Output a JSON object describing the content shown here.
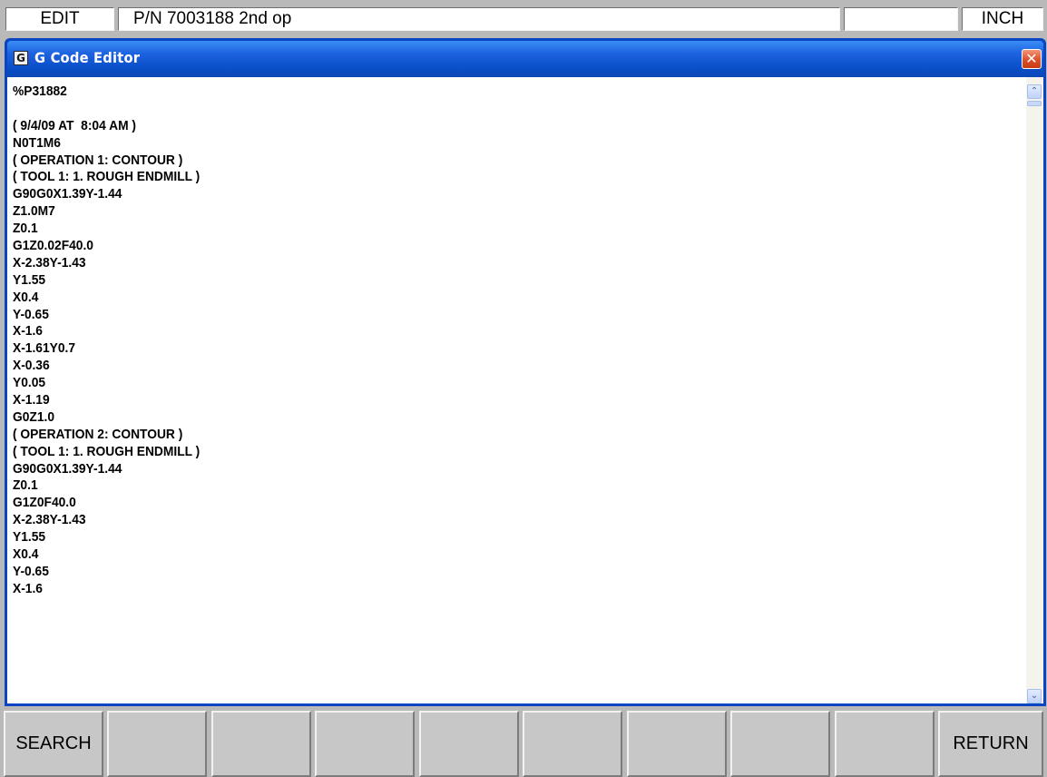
{
  "statusbar": {
    "mode": "EDIT",
    "program": "P/N 7003188 2nd op",
    "blank": "",
    "units": "INCH"
  },
  "window": {
    "title": "G Code Editor",
    "icon": "g-code-app-icon",
    "close_glyph": "✕"
  },
  "editor": {
    "lines": [
      "%P31882",
      "",
      "( 9/4/09 AT  8:04 AM )",
      "N0T1M6",
      "( OPERATION 1: CONTOUR )",
      "( TOOL 1: 1. ROUGH ENDMILL )",
      "G90G0X1.39Y-1.44",
      "Z1.0M7",
      "Z0.1",
      "G1Z0.02F40.0",
      "X-2.38Y-1.43",
      "Y1.55",
      "X0.4",
      "Y-0.65",
      "X-1.6",
      "X-1.61Y0.7",
      "X-0.36",
      "Y0.05",
      "X-1.19",
      "G0Z1.0",
      "( OPERATION 2: CONTOUR )",
      "( TOOL 1: 1. ROUGH ENDMILL )",
      "G90G0X1.39Y-1.44",
      "Z0.1",
      "G1Z0F40.0",
      "X-2.38Y-1.43",
      "Y1.55",
      "X0.4",
      "Y-0.65",
      "X-1.6"
    ]
  },
  "scrollbar": {
    "up_glyph": "⌃",
    "down_glyph": "⌄"
  },
  "softkeys": [
    "SEARCH",
    "",
    "",
    "",
    "",
    "",
    "",
    "",
    "",
    "RETURN"
  ],
  "colors": {
    "background": "#b9b9b9",
    "titlebar": "#0a4ec8",
    "close_button": "#dc5028",
    "editor_bg": "#ffffff"
  }
}
